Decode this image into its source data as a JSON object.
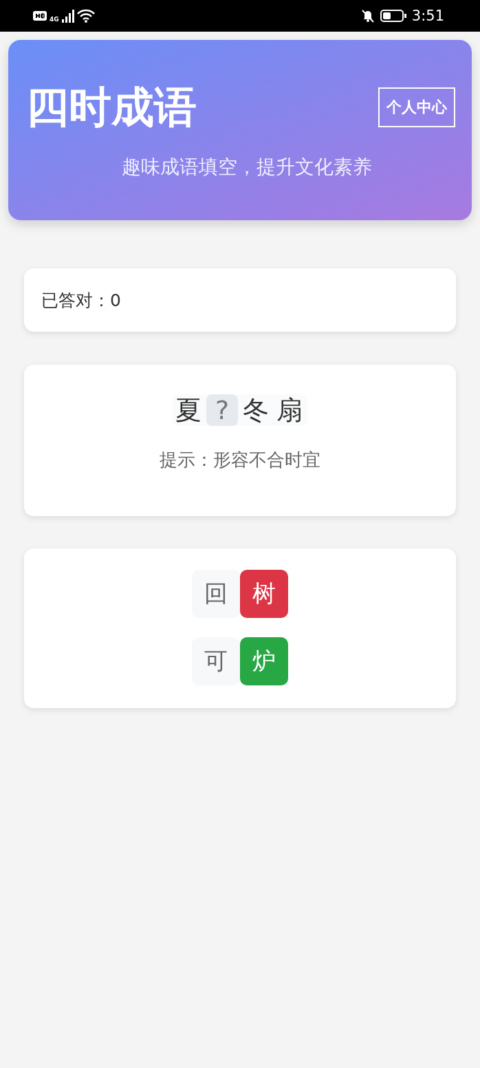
{
  "status_bar": {
    "time": "3:51",
    "network": "4G"
  },
  "header": {
    "title": "四时成语",
    "subtitle": "趣味成语填空，提升文化素养",
    "profile_button": "个人中心"
  },
  "score": {
    "text": "已答对：0"
  },
  "puzzle": {
    "chars": [
      {
        "kind": "char",
        "text": "夏"
      },
      {
        "kind": "blank",
        "text": "?"
      },
      {
        "kind": "char",
        "text": "冬"
      },
      {
        "kind": "char",
        "text": "扇"
      }
    ],
    "hint": "提示：形容不合时宜"
  },
  "options": [
    [
      {
        "text": "回",
        "kind": "normal"
      },
      {
        "text": "树",
        "kind": "wrong"
      }
    ],
    [
      {
        "text": "可",
        "kind": "normal"
      },
      {
        "text": "炉",
        "kind": "correct"
      }
    ]
  ]
}
